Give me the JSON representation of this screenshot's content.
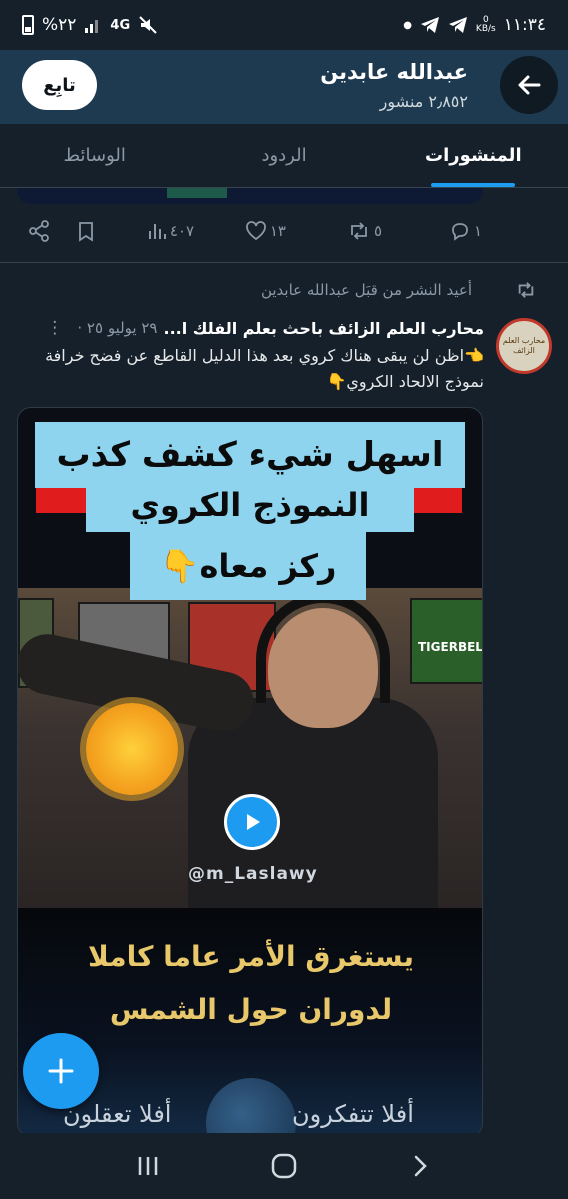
{
  "status_bar": {
    "time": "١١:٣٤",
    "battery": "%٢٢",
    "network": "4G",
    "speed_value": "0",
    "speed_unit": "KB/s"
  },
  "header": {
    "title": "عبدالله عابدين",
    "subtitle": "٢٫٨٥٢ منشور",
    "follow_label": "تابِع"
  },
  "tabs": [
    {
      "label": "المنشورات",
      "active": true
    },
    {
      "label": "الردود",
      "active": false
    },
    {
      "label": "الوسائط",
      "active": false
    }
  ],
  "prev_tweet_actions": {
    "replies": "١",
    "retweets": "٥",
    "likes": "١٣",
    "views": "٤٠٧"
  },
  "retweet_line": "أعيد النشر من قبَل عبدالله عابدين",
  "tweet": {
    "author": "محارب العلم الزائف باحث بعلم الفلك ا...",
    "date": "٢٩ يوليو ٢٥ ·",
    "text": "👈اظن لن يبقى هناك كروي بعد هذا الدليل القاطع عن فضح خرافة نموذج الالحاد الكروي👇",
    "avatar_text": "محارب العلم الزائف"
  },
  "media": {
    "caption_line1": "اسهل شيء كشف كذب",
    "caption_line2": "النموذج الكروي",
    "caption_line3": "ركز معاه👇",
    "poster_text": "TIGERBEL",
    "watermark": "@m_Laslawy",
    "gold_line1": "يستغرق الأمر عاما كاملا",
    "gold_line2": "لدوران حول الشمس",
    "bottom_right": "أفلا تتفكرون",
    "bottom_left": "أفلا تعقلون"
  },
  "colors": {
    "background": "#15202b",
    "header": "#1e3a50",
    "accent": "#1d9bf0",
    "caption_bg": "#8ed4ee"
  }
}
